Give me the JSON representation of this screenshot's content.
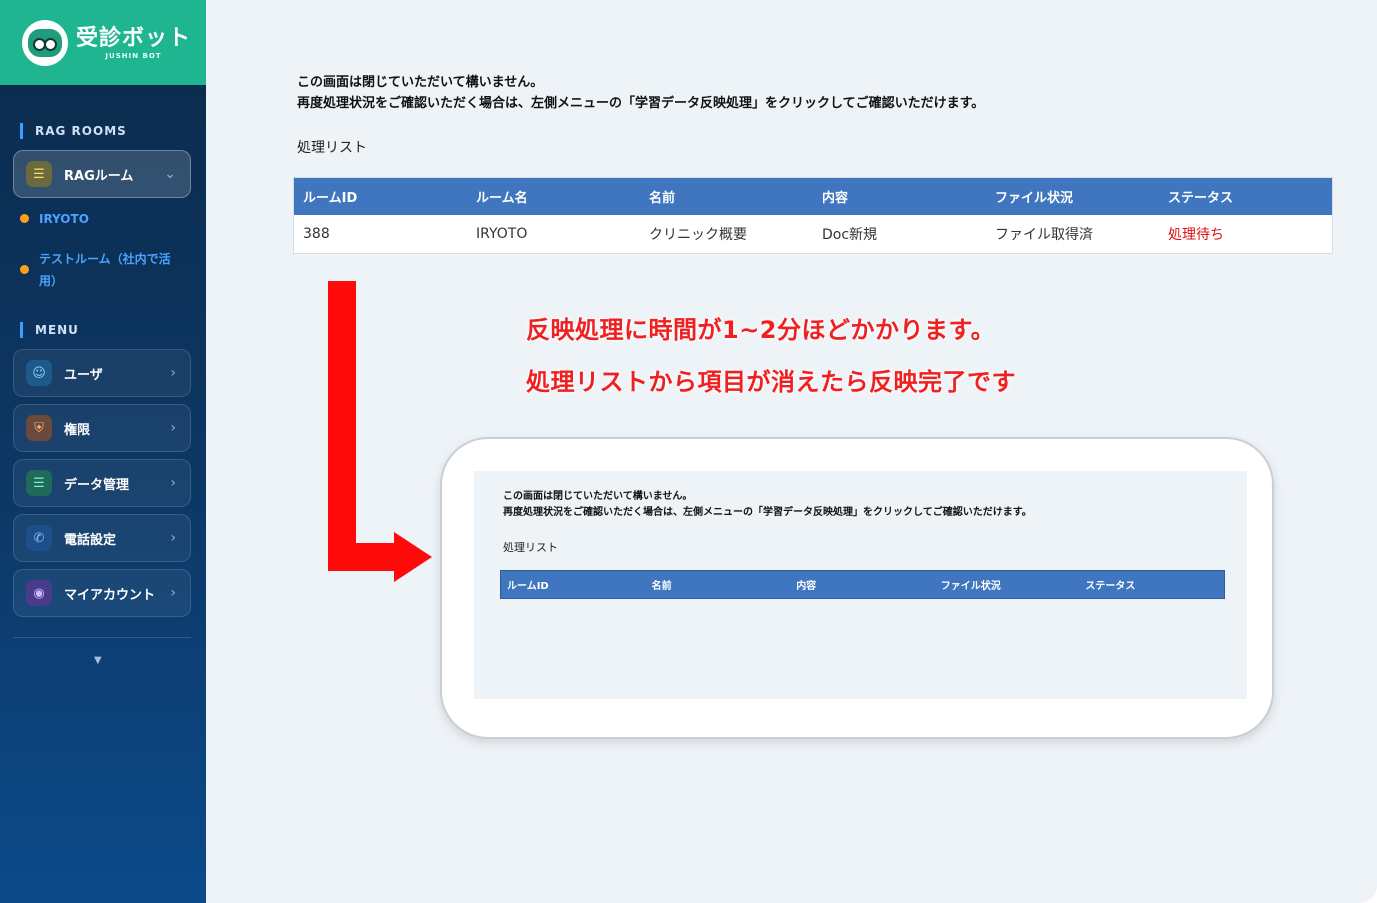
{
  "brand": {
    "title": "受診ボット",
    "subtitle": "JUSHIN BOT"
  },
  "sidebar": {
    "rag_section": "RAG ROOMS",
    "rag_button": "RAGルーム",
    "rooms": [
      "IRYOTO",
      "テストルーム（社内で活用）"
    ],
    "rooms_lines": [
      "テストルーム（社内で活",
      "用）"
    ],
    "menu_section": "MENU",
    "menu": [
      {
        "label": "ユーザ",
        "icon": "user-icon"
      },
      {
        "label": "権限",
        "icon": "shield-icon"
      },
      {
        "label": "データ管理",
        "icon": "database-icon"
      },
      {
        "label": "電話設定",
        "icon": "phone-icon"
      },
      {
        "label": "マイアカウント",
        "icon": "account-icon"
      }
    ]
  },
  "main": {
    "notice_line1": "この画面は閉じていただいて構いません。",
    "notice_line2": "再度処理状況をご確認いただく場合は、左側メニューの「学習データ反映処理」をクリックしてご確認いただけます。",
    "list_title": "処理リスト",
    "table": {
      "headers": [
        "ルームID",
        "ルーム名",
        "名前",
        "内容",
        "ファイル状況",
        "ステータス"
      ],
      "rows": [
        [
          "388",
          "IRYOTO",
          "クリニック概要",
          "Doc新規",
          "ファイル取得済",
          "処理待ち"
        ]
      ]
    },
    "annotation_line1": "反映処理に時間が1~2分ほどかかります。",
    "annotation_line2": "処理リストから項目が消えたら反映完了です",
    "preview": {
      "notice_line1": "この画面は閉じていただいて構いません。",
      "notice_line2": "再度処理状況をご確認いただく場合は、左側メニューの「学習データ反映処理」をクリックしてご確認いただけます。",
      "list_title": "処理リスト",
      "headers": [
        "ルームID",
        "名前",
        "内容",
        "ファイル状況",
        "ステータス"
      ]
    }
  },
  "colors": {
    "accent": "#1fb590",
    "table_header": "#3f76bf",
    "status_red": "#e01010",
    "annotation_red": "#f02020"
  }
}
